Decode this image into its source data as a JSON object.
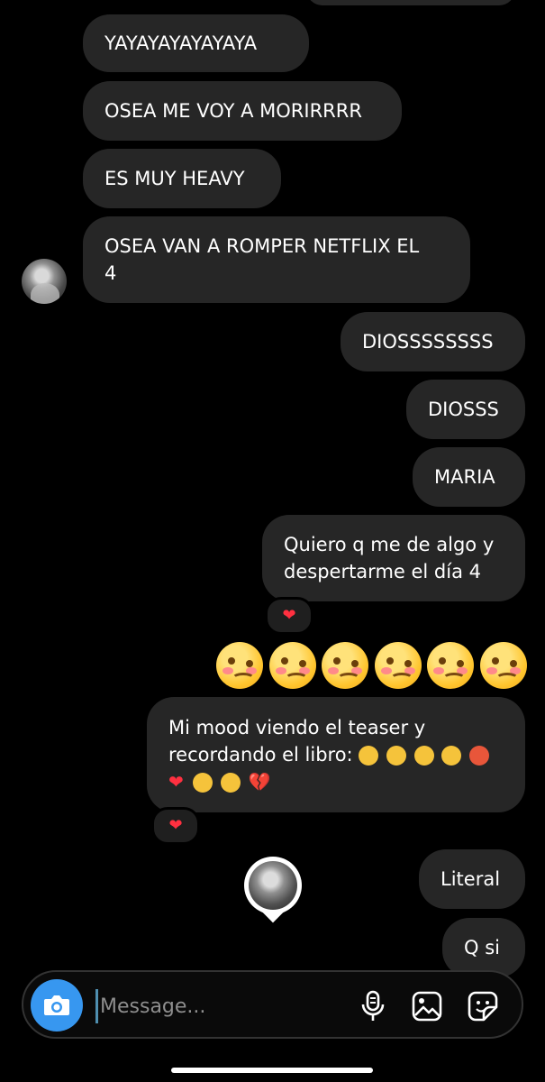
{
  "messages": {
    "m1": "YAYAYAYAYAYAYA",
    "m2": "OSEA ME VOY A MORIRRRR",
    "m3": "ES MUY HEAVY",
    "m4_line1": "OSEA VAN A ROMPER NETFLIX EL",
    "m4_line2": "4",
    "s1": "DIOSSSSSSSS",
    "s2": "DIOSSS",
    "s3": "MARIA",
    "s4_line1": "Quiero q me de algo y",
    "s4_line2": "despertarme el día 4",
    "s5_line1": "Mi mood viendo el teaser y",
    "s5_line2": "recordando el libro:",
    "s6": "Literal",
    "s7": "Q si"
  },
  "reactions": {
    "r1": "❤",
    "r2": "❤"
  },
  "emoji_row": [
    "woozy-face",
    "woozy-face",
    "woozy-face",
    "woozy-face",
    "woozy-face",
    "woozy-face"
  ],
  "composer": {
    "placeholder": "Message..."
  },
  "colors": {
    "bubble": "#262626",
    "accent": "#3797f0",
    "heart": "#ff3040"
  }
}
